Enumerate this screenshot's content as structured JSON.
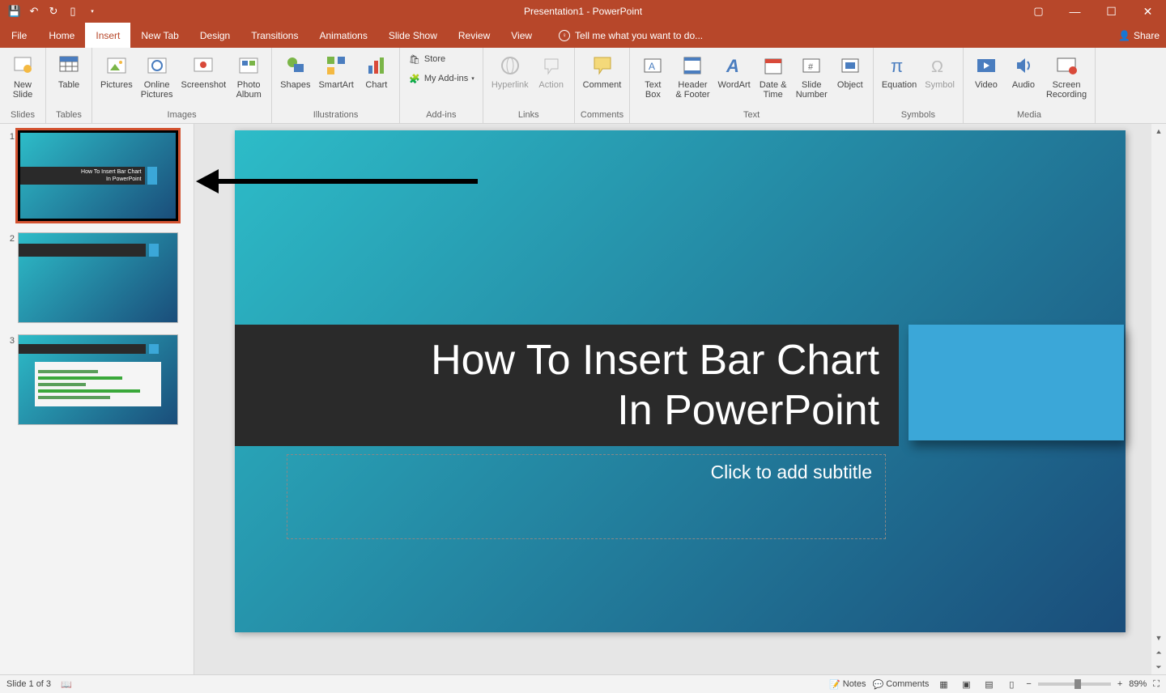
{
  "title": "Presentation1 - PowerPoint",
  "tabs": {
    "file": "File",
    "home": "Home",
    "insert": "Insert",
    "newtab": "New Tab",
    "design": "Design",
    "transitions": "Transitions",
    "animations": "Animations",
    "slideshow": "Slide Show",
    "review": "Review",
    "view": "View"
  },
  "tellme": "Tell me what you want to do...",
  "share": "Share",
  "ribbon": {
    "slides": {
      "newslide": "New\nSlide",
      "group": "Slides"
    },
    "tables": {
      "table": "Table",
      "group": "Tables"
    },
    "images": {
      "pictures": "Pictures",
      "online": "Online\nPictures",
      "screenshot": "Screenshot",
      "album": "Photo\nAlbum",
      "group": "Images"
    },
    "illustrations": {
      "shapes": "Shapes",
      "smartart": "SmartArt",
      "chart": "Chart",
      "group": "Illustrations"
    },
    "addins": {
      "store": "Store",
      "myaddins": "My Add-ins",
      "group": "Add-ins"
    },
    "links": {
      "hyperlink": "Hyperlink",
      "action": "Action",
      "group": "Links"
    },
    "comments": {
      "comment": "Comment",
      "group": "Comments"
    },
    "text": {
      "textbox": "Text\nBox",
      "header": "Header\n& Footer",
      "wordart": "WordArt",
      "datetime": "Date &\nTime",
      "slidenum": "Slide\nNumber",
      "object": "Object",
      "group": "Text"
    },
    "symbols": {
      "equation": "Equation",
      "symbol": "Symbol",
      "group": "Symbols"
    },
    "media": {
      "video": "Video",
      "audio": "Audio",
      "screenrec": "Screen\nRecording",
      "group": "Media"
    }
  },
  "thumbs": {
    "n1": "1",
    "n2": "2",
    "n3": "3",
    "title": "How To Insert Bar Chart\nIn PowerPoint"
  },
  "slide": {
    "title": "How To Insert Bar Chart\nIn PowerPoint",
    "subtitle": "Click to add subtitle"
  },
  "status": {
    "slideof": "Slide 1 of 3",
    "notes": "Notes",
    "comments": "Comments",
    "zoom": "89%"
  }
}
